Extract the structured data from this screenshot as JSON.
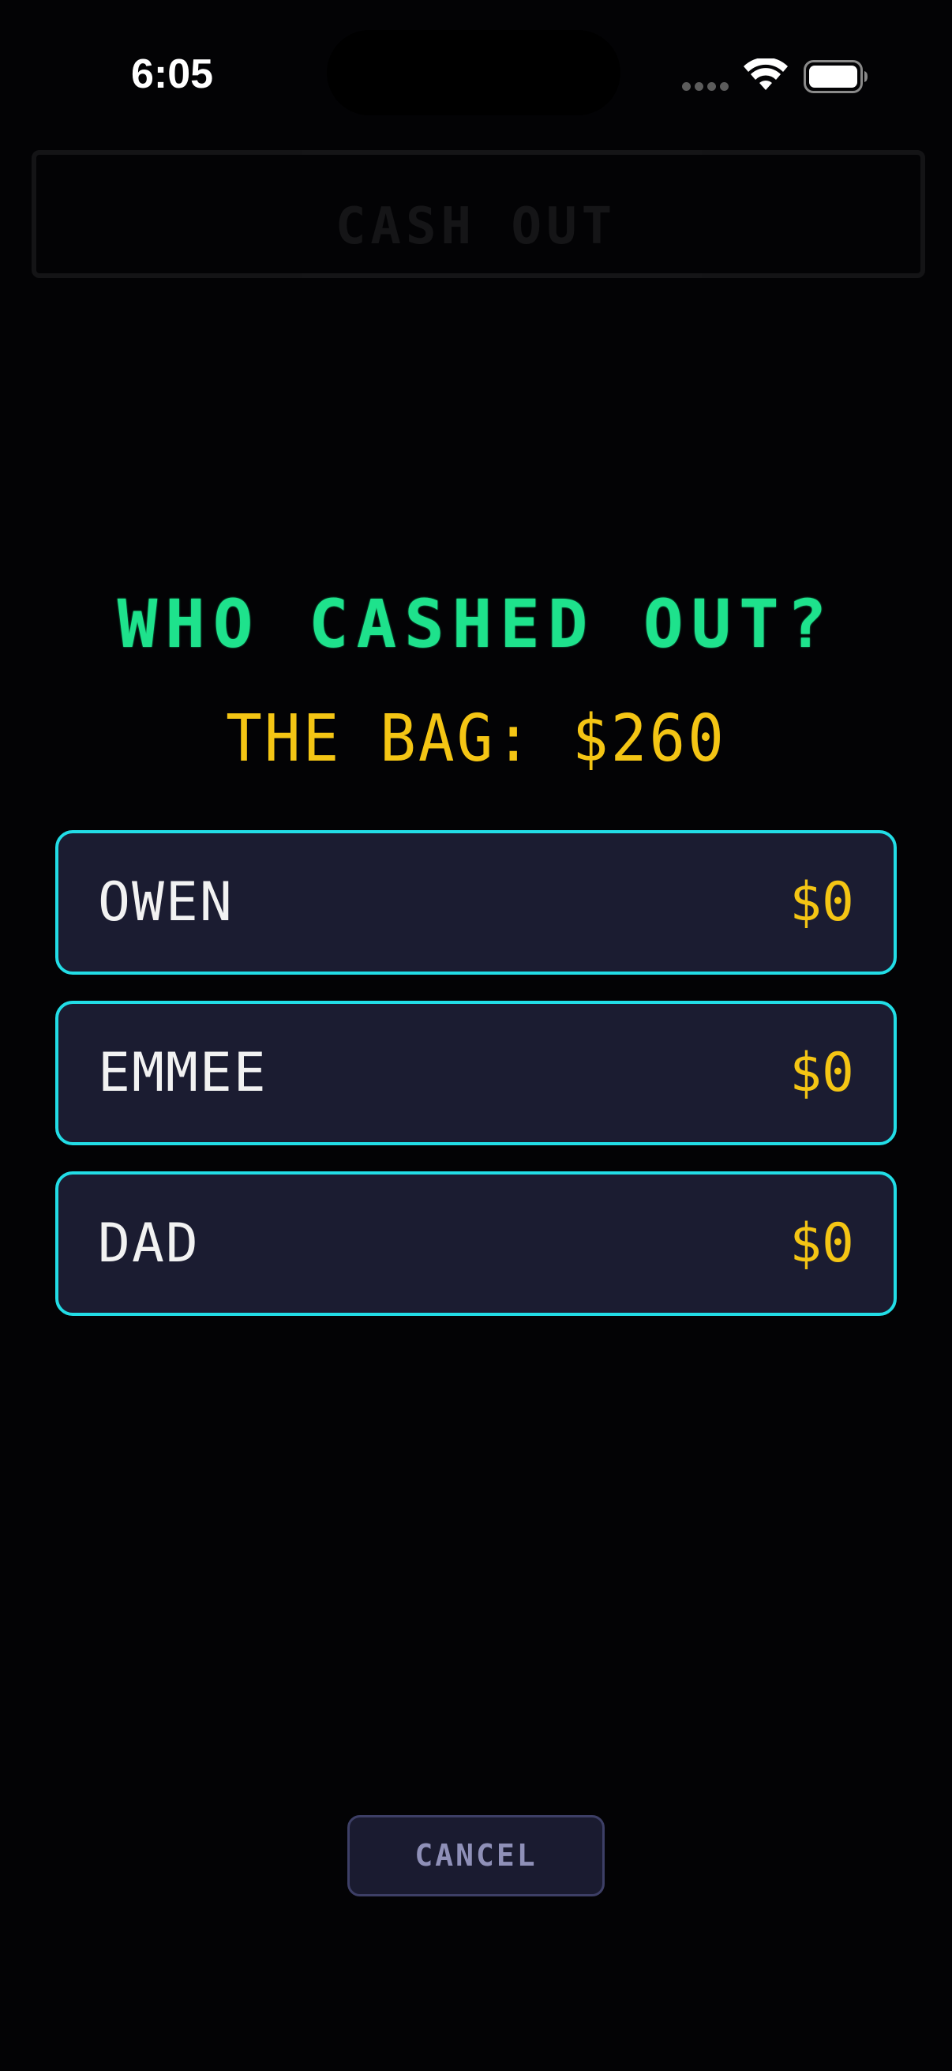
{
  "status_bar": {
    "time": "6:05",
    "icons": [
      "cellular-signal-icon",
      "wifi-icon",
      "battery-icon"
    ]
  },
  "background_screen": {
    "title": "CASH OUT"
  },
  "modal": {
    "title": "WHO CASHED OUT?",
    "bag_label": "THE BAG: $260",
    "players": [
      {
        "name": "OWEN",
        "amount": "$0"
      },
      {
        "name": "EMMEE",
        "amount": "$0"
      },
      {
        "name": "DAD",
        "amount": "$0"
      }
    ],
    "cancel_label": "CANCEL"
  },
  "colors": {
    "background": "#030305",
    "title_green": "#1ee28c",
    "money_yellow": "#f4c514",
    "row_border_cyan": "#22dde6",
    "row_fill": "#1b1c31",
    "cancel_text": "#8f90b8"
  }
}
